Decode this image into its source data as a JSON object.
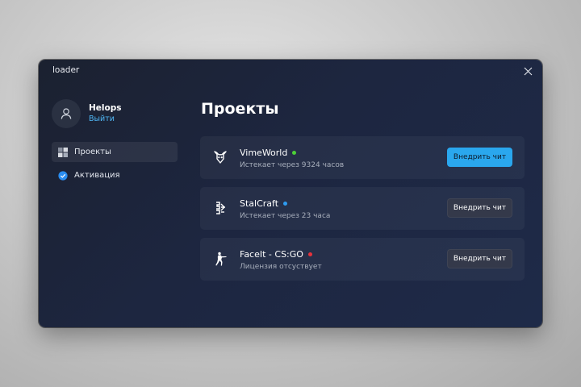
{
  "window": {
    "title": "loader"
  },
  "profile": {
    "username": "Helops",
    "logout_label": "Выйти",
    "avatar_icon": "user-icon"
  },
  "sidebar": {
    "items": [
      {
        "label": "Проекты",
        "icon": "grid-icon",
        "active": true
      },
      {
        "label": "Активация",
        "icon": "check-circle-icon",
        "active": false
      }
    ]
  },
  "main": {
    "title": "Проекты"
  },
  "projects": [
    {
      "name": "VimeWorld",
      "status_color": "#4cd137",
      "subtitle": "Истекает через 9324 часов",
      "button_label": "Внедрить чит",
      "button_primary": true,
      "icon": "vimeworld-logo-icon"
    },
    {
      "name": "StalCraft",
      "status_color": "#2e9bf0",
      "subtitle": "Истекает через 23 часа",
      "button_label": "Внедрить чит",
      "button_primary": false,
      "icon": "stalcraft-logo-icon"
    },
    {
      "name": "FaceIt - CS:GO",
      "status_color": "#e8323c",
      "subtitle": "Лицензия отсуствует",
      "button_label": "Внедрить чит",
      "button_primary": false,
      "icon": "csgo-soldier-icon"
    }
  ],
  "colors": {
    "accent": "#2aa7ee",
    "link": "#4fb6f4"
  }
}
